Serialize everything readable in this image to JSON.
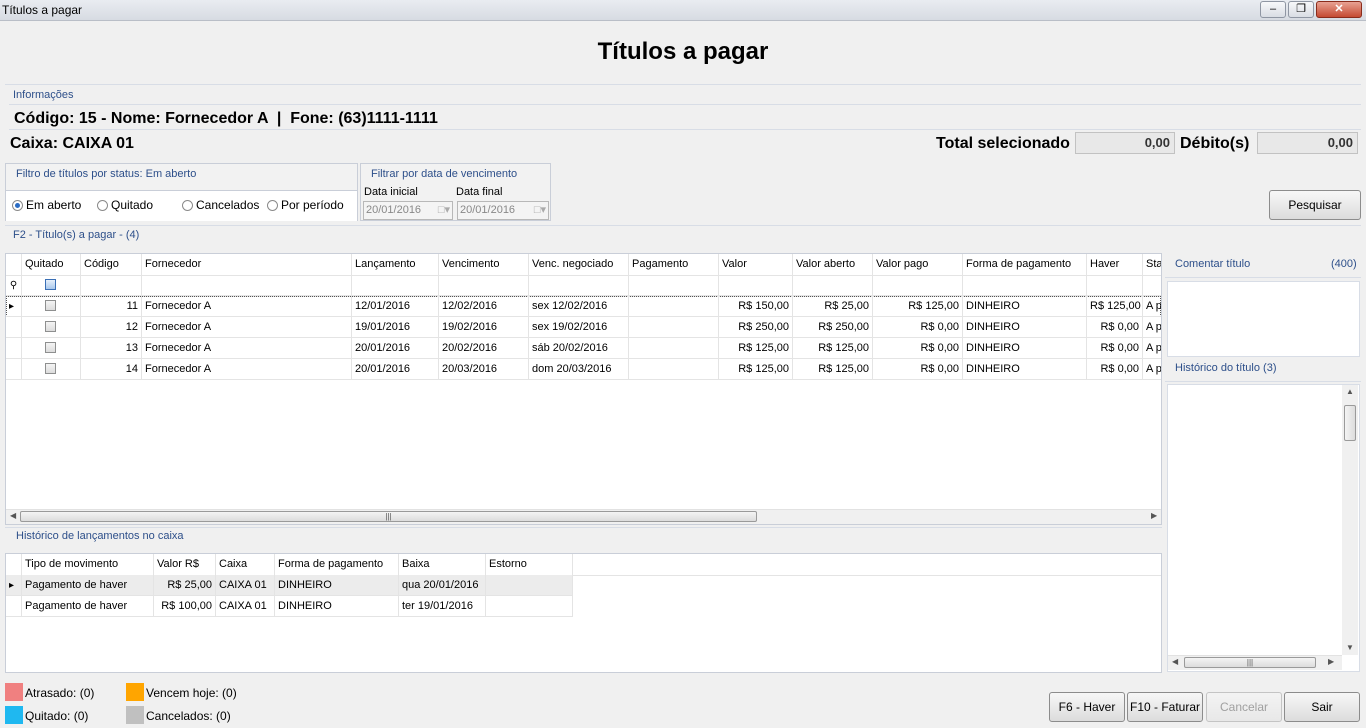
{
  "window": {
    "title": "Títulos a pagar",
    "controls": [
      "minimize",
      "maximize",
      "close"
    ]
  },
  "header": {
    "title": "Títulos a pagar"
  },
  "info": {
    "group_label": "Informações",
    "line": "Código: 15 - Nome: Fornecedor A  |  Fone: (63)1111-1111",
    "caixa": "Caixa: CAIXA 01",
    "total_label": "Total selecionado",
    "total_value": "0,00",
    "debito_label": "Débito(s)",
    "debito_value": "0,00"
  },
  "status_filter": {
    "group_label": "Filtro de títulos por status: Em aberto",
    "options": [
      "Em aberto",
      "Quitado",
      "Cancelados",
      "Por período"
    ],
    "selected": "Em aberto"
  },
  "date_filter": {
    "group_label": "Filtrar por data de vencimento",
    "start_label": "Data inicial",
    "start_value": "20/01/2016",
    "end_label": "Data final",
    "end_value": "20/01/2016"
  },
  "search_button": "Pesquisar",
  "titles_grid": {
    "group_label": "F2 - Título(s) a pagar - (4)",
    "columns": [
      "Quitado",
      "Código",
      "Fornecedor",
      "Lançamento",
      "Vencimento",
      "Venc. negociado",
      "Pagamento",
      "Valor",
      "Valor aberto",
      "Valor pago",
      "Forma de pagamento",
      "Haver",
      "Sta"
    ],
    "rows": [
      {
        "codigo": "11",
        "fornecedor": "Fornecedor A",
        "lancamento": "12/01/2016",
        "vencimento": "12/02/2016",
        "venc_negociado": "sex 12/02/2016",
        "pagamento": "",
        "valor": "R$ 150,00",
        "valor_aberto": "R$ 25,00",
        "valor_pago": "R$ 125,00",
        "forma": "DINHEIRO",
        "haver": "R$ 125,00",
        "status": "A p"
      },
      {
        "codigo": "12",
        "fornecedor": "Fornecedor A",
        "lancamento": "19/01/2016",
        "vencimento": "19/02/2016",
        "venc_negociado": "sex 19/02/2016",
        "pagamento": "",
        "valor": "R$ 250,00",
        "valor_aberto": "R$ 250,00",
        "valor_pago": "R$ 0,00",
        "forma": "DINHEIRO",
        "haver": "R$ 0,00",
        "status": "A p"
      },
      {
        "codigo": "13",
        "fornecedor": "Fornecedor A",
        "lancamento": "20/01/2016",
        "vencimento": "20/02/2016",
        "venc_negociado": "sáb 20/02/2016",
        "pagamento": "",
        "valor": "R$ 125,00",
        "valor_aberto": "R$ 125,00",
        "valor_pago": "R$ 0,00",
        "forma": "DINHEIRO",
        "haver": "R$ 0,00",
        "status": "A p"
      },
      {
        "codigo": "14",
        "fornecedor": "Fornecedor A",
        "lancamento": "20/01/2016",
        "vencimento": "20/03/2016",
        "venc_negociado": "dom 20/03/2016",
        "pagamento": "",
        "valor": "R$ 125,00",
        "valor_aberto": "R$ 125,00",
        "valor_pago": "R$ 0,00",
        "forma": "DINHEIRO",
        "haver": "R$ 0,00",
        "status": "A p"
      }
    ]
  },
  "comment_panel": {
    "label": "Comentar título",
    "count": "(400)"
  },
  "history_panel": {
    "label": "Histórico do título (3)"
  },
  "cash_history": {
    "group_label": "Histórico de lançamentos no caixa",
    "columns": [
      "Tipo de movimento",
      "Valor R$",
      "Caixa",
      "Forma de pagamento",
      "Baixa",
      "Estorno"
    ],
    "rows": [
      {
        "tipo": "Pagamento de haver",
        "valor": "R$ 25,00",
        "caixa": "CAIXA 01",
        "forma": "DINHEIRO",
        "baixa": "qua 20/01/2016",
        "estorno": ""
      },
      {
        "tipo": "Pagamento de haver",
        "valor": "R$ 100,00",
        "caixa": "CAIXA 01",
        "forma": "DINHEIRO",
        "baixa": "ter 19/01/2016",
        "estorno": ""
      }
    ]
  },
  "legend": [
    {
      "label": "Atrasado: (0)",
      "color": "#f08080"
    },
    {
      "label": "Vencem hoje: (0)",
      "color": "#ffa500"
    },
    {
      "label": "Quitado: (0)",
      "color": "#1fb8f0"
    },
    {
      "label": "Cancelados: (0)",
      "color": "#c0c0c0"
    }
  ],
  "buttons": {
    "haver": "F6 - Haver",
    "faturar": "F10 - Faturar",
    "cancelar": "Cancelar",
    "sair": "Sair"
  }
}
